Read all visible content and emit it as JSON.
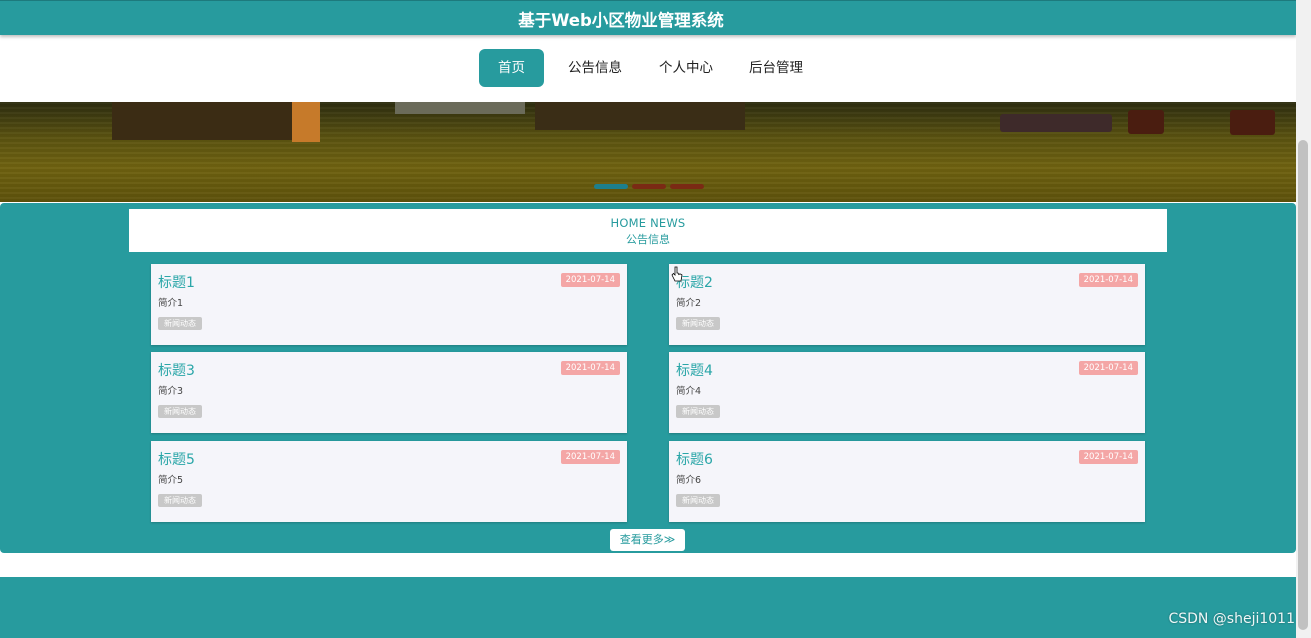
{
  "header": {
    "title": "基于Web小区物业管理系统"
  },
  "nav": {
    "items": [
      {
        "label": "首页"
      },
      {
        "label": "公告信息"
      },
      {
        "label": "个人中心"
      },
      {
        "label": "后台管理"
      }
    ],
    "active_index": 0
  },
  "banner": {
    "slide_count": 3,
    "active_slide": 0,
    "colors": {
      "active_dot": "#1d7f8c",
      "inactive_dot": "#7a2a14"
    }
  },
  "news": {
    "title_en": "HOME NEWS",
    "title_zh": "公告信息",
    "items": [
      {
        "title": "标题1",
        "date": "2021-07-14",
        "summary": "简介1",
        "tag": "新闻动态"
      },
      {
        "title": "标题2",
        "date": "2021-07-14",
        "summary": "简介2",
        "tag": "新闻动态"
      },
      {
        "title": "标题3",
        "date": "2021-07-14",
        "summary": "简介3",
        "tag": "新闻动态"
      },
      {
        "title": "标题4",
        "date": "2021-07-14",
        "summary": "简介4",
        "tag": "新闻动态"
      },
      {
        "title": "标题5",
        "date": "2021-07-14",
        "summary": "简介5",
        "tag": "新闻动态"
      },
      {
        "title": "标题6",
        "date": "2021-07-14",
        "summary": "简介6",
        "tag": "新闻动态"
      }
    ],
    "more_label": "查看更多≫"
  },
  "watermark": "CSDN @sheji1011",
  "colors": {
    "primary": "#279b9e",
    "date_badge": "#f4a6a6",
    "tag_badge": "#c8c8c8",
    "card_bg": "#f5f5fa"
  }
}
